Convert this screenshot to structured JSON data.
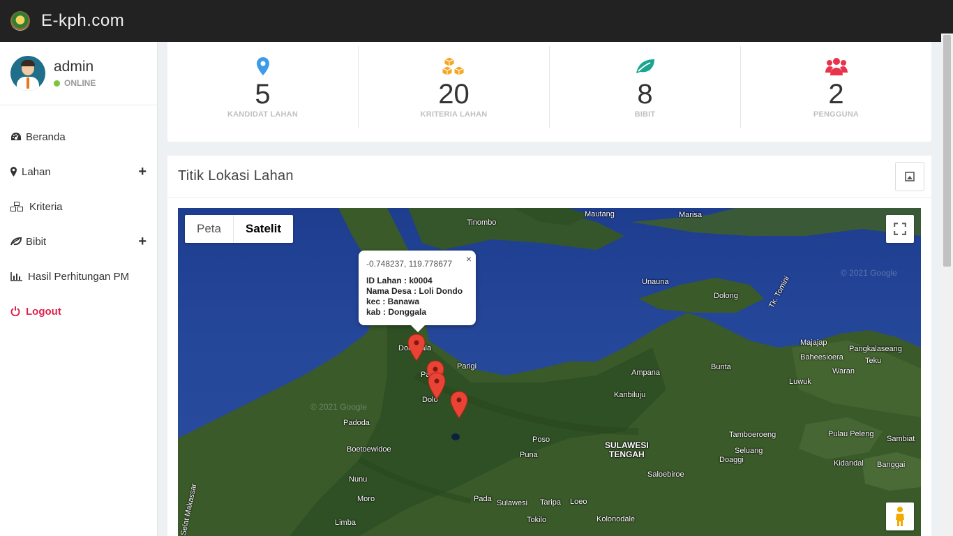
{
  "brand": {
    "name": "E-kph.com"
  },
  "user": {
    "name": "admin",
    "status": "ONLINE"
  },
  "menu": {
    "items": [
      {
        "label": "Beranda",
        "icon": "dashboard-icon"
      },
      {
        "label": "Lahan",
        "icon": "map-marker-icon",
        "expand": "+"
      },
      {
        "label": "Kriteria",
        "icon": "cubes-icon"
      },
      {
        "label": "Bibit",
        "icon": "leaf-icon",
        "expand": "+"
      },
      {
        "label": "Hasil Perhitungan PM",
        "icon": "bar-chart-icon"
      },
      {
        "label": "Logout",
        "icon": "power-icon"
      }
    ]
  },
  "stats": [
    {
      "value": "5",
      "label": "KANDIDAT LAHAN",
      "icon": "map-marker-icon",
      "color": "#3d9be9"
    },
    {
      "value": "20",
      "label": "KRITERIA LAHAN",
      "icon": "cubes-icon",
      "color": "#f5a623"
    },
    {
      "value": "8",
      "label": "BIBIT",
      "icon": "leaf-icon",
      "color": "#1aa58f"
    },
    {
      "value": "2",
      "label": "PENGGUNA",
      "icon": "users-icon",
      "color": "#e8334b"
    }
  ],
  "panel": {
    "title": "Titik Lokasi Lahan",
    "button_icon": "image-icon"
  },
  "map": {
    "type_options": [
      "Peta",
      "Satelit"
    ],
    "selected_type": "Satelit",
    "watermark": "© 2021 Google",
    "popup": {
      "coord": "-0.748237, 119.778677",
      "lines": [
        "ID Lahan : k0004",
        "Nama Desa : Loli Dondo",
        "kec : Banawa",
        "kab : Donggala"
      ],
      "close": "×"
    },
    "labels": {
      "mautang": "Mautang",
      "marisa": "Marisa",
      "tinombo": "Tinombo",
      "unauna": "Unauna",
      "dolong": "Dolong",
      "tkTomini": "Tk. Tomini",
      "majajap": "Majajap",
      "pangkalaseang": "Pangkalaseang",
      "baheesiosera": "Baheesioera",
      "teku": "Teku",
      "waran": "Waran",
      "luwuk": "Luwuk",
      "bunta": "Bunta",
      "ampana": "Ampana",
      "parigi": "Parigi",
      "donggala": "Donggala",
      "palu": "Palu",
      "dolo": "Dolo",
      "kanbiluju": "Kanbiluju",
      "padoda": "Padoda",
      "boetoewidoe": "Boetoewidoe",
      "poso": "Poso",
      "puna": "Puna",
      "sulteng1": "SULAWESI",
      "sulteng2": "TENGAH",
      "tamboeroeng": "Tamboeroeng",
      "seluang": "Seluang",
      "doaggi": "Doaggi",
      "pulauPeleng": "Pulau Peleng",
      "sambiat": "Sambiat",
      "kidandal": "Kidandal",
      "banggai": "Banggai",
      "saloebiroe": "Saloebiroe",
      "nunu": "Nunu",
      "moro": "Moro",
      "pada": "Pada",
      "sulawesi": "Sulawesi",
      "taripa": "Taripa",
      "loeo": "Loeo",
      "limba": "Limba",
      "tokilo": "Tokilo",
      "kolonodale": "Kolonodale",
      "selatMakassar": "Selat Makassar"
    }
  }
}
